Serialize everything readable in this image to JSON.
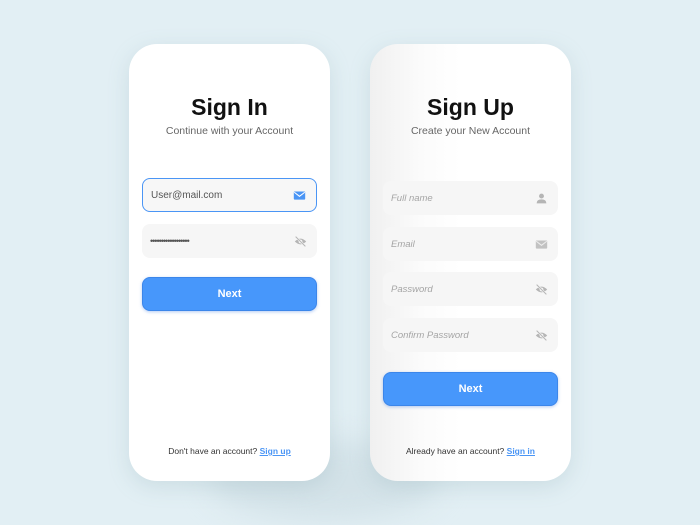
{
  "colors": {
    "accent": "#4797fb",
    "background": "#e2eff4"
  },
  "signin": {
    "title": "Sign In",
    "subtitle": "Continue with your Account",
    "email_value": "User@mail.com",
    "email_icon": "mail-icon",
    "password_value": "••••••••••••••••••",
    "password_icon": "eye-off-icon",
    "next_label": "Next",
    "footer_text": "Don't have an account? ",
    "footer_link": "Sign up"
  },
  "signup": {
    "title": "Sign Up",
    "subtitle": "Create your New Account",
    "fullname_placeholder": "Full name",
    "email_placeholder": "Email",
    "password_placeholder": "Password",
    "confirm_placeholder": "Confirm Password",
    "next_label": "Next",
    "footer_text": "Already have an account? ",
    "footer_link": "Sign in"
  }
}
